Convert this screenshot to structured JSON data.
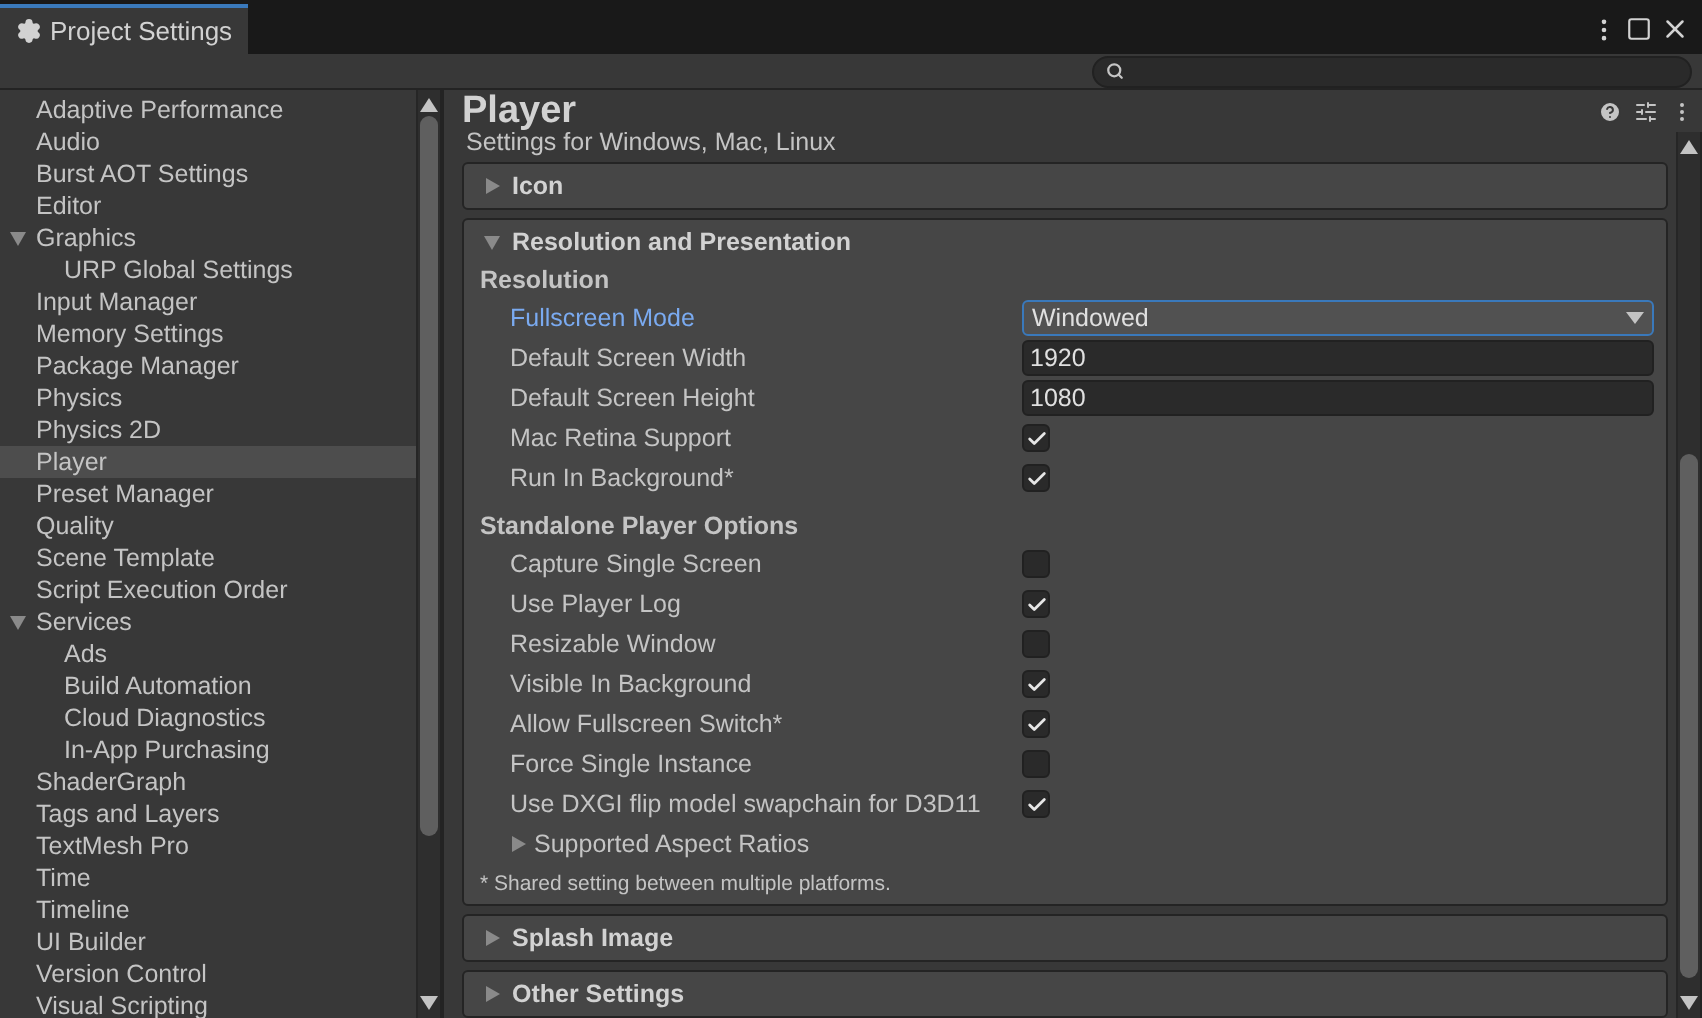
{
  "window": {
    "title": "Project Settings"
  },
  "sidebar": {
    "items": [
      {
        "label": "Adaptive Performance",
        "selected": false
      },
      {
        "label": "Audio",
        "selected": false
      },
      {
        "label": "Burst AOT Settings",
        "selected": false
      },
      {
        "label": "Editor",
        "selected": false
      },
      {
        "label": "Graphics",
        "selected": false,
        "expanded": true,
        "children": [
          {
            "label": "URP Global Settings",
            "selected": false
          }
        ]
      },
      {
        "label": "Input Manager",
        "selected": false
      },
      {
        "label": "Memory Settings",
        "selected": false
      },
      {
        "label": "Package Manager",
        "selected": false
      },
      {
        "label": "Physics",
        "selected": false
      },
      {
        "label": "Physics 2D",
        "selected": false
      },
      {
        "label": "Player",
        "selected": true
      },
      {
        "label": "Preset Manager",
        "selected": false
      },
      {
        "label": "Quality",
        "selected": false
      },
      {
        "label": "Scene Template",
        "selected": false
      },
      {
        "label": "Script Execution Order",
        "selected": false
      },
      {
        "label": "Services",
        "selected": false,
        "expanded": true,
        "children": [
          {
            "label": "Ads",
            "selected": false
          },
          {
            "label": "Build Automation",
            "selected": false
          },
          {
            "label": "Cloud Diagnostics",
            "selected": false
          },
          {
            "label": "In-App Purchasing",
            "selected": false
          }
        ]
      },
      {
        "label": "ShaderGraph",
        "selected": false
      },
      {
        "label": "Tags and Layers",
        "selected": false
      },
      {
        "label": "TextMesh Pro",
        "selected": false
      },
      {
        "label": "Time",
        "selected": false
      },
      {
        "label": "Timeline",
        "selected": false
      },
      {
        "label": "UI Builder",
        "selected": false
      },
      {
        "label": "Version Control",
        "selected": false
      },
      {
        "label": "Visual Scripting",
        "selected": false
      }
    ]
  },
  "inspector": {
    "title": "Player",
    "caption": "Settings for Windows, Mac, Linux"
  },
  "sections": [
    {
      "title": "Icon",
      "expanded": false
    },
    {
      "title": "Resolution and Presentation",
      "expanded": true,
      "groups": [
        {
          "title": "Resolution",
          "rows": [
            {
              "kind": "dropdown",
              "label": "Fullscreen Mode",
              "value": "Windowed",
              "focused": true
            },
            {
              "kind": "number",
              "label": "Default Screen Width",
              "value": "1920",
              "focused": false
            },
            {
              "kind": "number",
              "label": "Default Screen Height",
              "value": "1080",
              "focused": false
            },
            {
              "kind": "checkbox",
              "label": "Mac Retina Support",
              "checked": true,
              "focused": false
            },
            {
              "kind": "checkbox",
              "label": "Run In Background*",
              "checked": true,
              "focused": false
            }
          ]
        },
        {
          "title": "Standalone Player Options",
          "rows": [
            {
              "kind": "checkbox",
              "label": "Capture Single Screen",
              "checked": false,
              "focused": false
            },
            {
              "kind": "checkbox",
              "label": "Use Player Log",
              "checked": true,
              "focused": false
            },
            {
              "kind": "checkbox",
              "label": "Resizable Window",
              "checked": false,
              "focused": false
            },
            {
              "kind": "checkbox",
              "label": "Visible In Background",
              "checked": true,
              "focused": false
            },
            {
              "kind": "checkbox",
              "label": "Allow Fullscreen Switch*",
              "checked": true,
              "focused": false
            },
            {
              "kind": "checkbox",
              "label": "Force Single Instance",
              "checked": false,
              "focused": false
            },
            {
              "kind": "checkbox",
              "label": "Use DXGI flip model swapchain for D3D11",
              "checked": true,
              "focused": false
            },
            {
              "kind": "foldout",
              "label": "Supported Aspect Ratios",
              "expanded": false,
              "focused": false
            }
          ]
        }
      ],
      "footnote": "* Shared setting between multiple platforms."
    },
    {
      "title": "Splash Image",
      "expanded": false
    },
    {
      "title": "Other Settings",
      "expanded": false
    }
  ]
}
